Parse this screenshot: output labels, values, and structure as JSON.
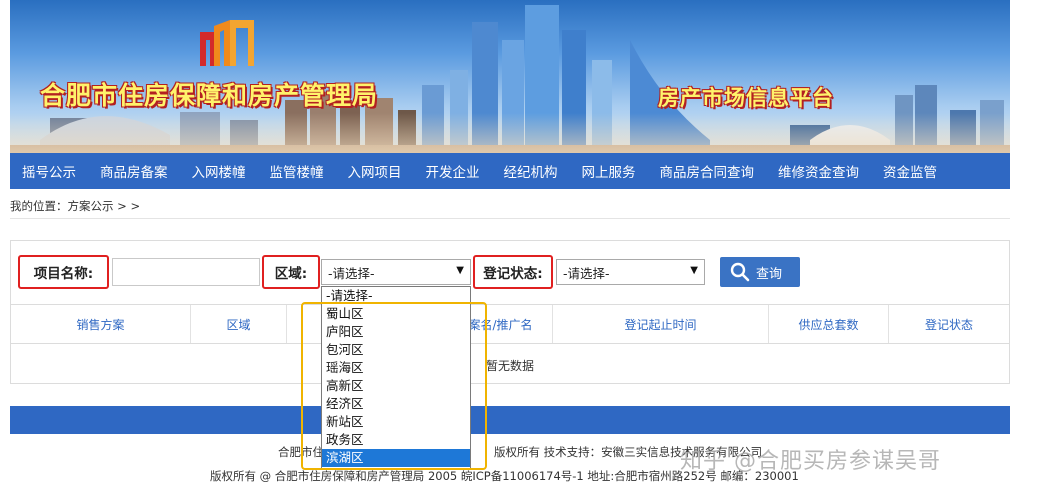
{
  "header": {
    "bureau_title": "合肥市住房保障和房产管理局",
    "platform_title": "房产市场信息平台"
  },
  "nav": {
    "items": [
      "摇号公示",
      "商品房备案",
      "入网楼幢",
      "监管楼幢",
      "入网项目",
      "开发企业",
      "经纪机构",
      "网上服务",
      "商品房合同查询",
      "维修资金查询",
      "资金监管"
    ]
  },
  "breadcrumb": "我的位置：方案公示 > >",
  "search": {
    "project_label": "项目名称:",
    "project_value": "",
    "region_label": "区域:",
    "region_selected": "-请选择-",
    "status_label": "登记状态:",
    "status_selected": "-请选择-",
    "search_button": "查询"
  },
  "region_options": [
    "-请选择-",
    "蜀山区",
    "庐阳区",
    "包河区",
    "瑶海区",
    "高新区",
    "经济区",
    "新站区",
    "政务区",
    "滨湖区"
  ],
  "region_hovered": "滨湖区",
  "table": {
    "columns": [
      "销售方案",
      "区域",
      "备案名/推广名",
      "登记起止时间",
      "供应总套数",
      "登记状态"
    ],
    "empty_text": "暂无数据"
  },
  "footer": {
    "line1_left": "合肥市住",
    "line1_right": "版权所有 技术支持：安徽三实信息技术服务有限公司",
    "line2": "版权所有 @ 合肥市住房保障和房产管理局 2005 皖ICP备11006174号-1 地址:合肥市宿州路252号 邮编：230001"
  },
  "watermark": "知乎 @合肥买房参谋吴哥",
  "colors": {
    "nav": "#2f68c3",
    "table_header_text": "#2f68c3",
    "label_highlight": "#e02020",
    "dropdown_highlight": "#f0b400",
    "option_selected": "#1e78d7"
  }
}
